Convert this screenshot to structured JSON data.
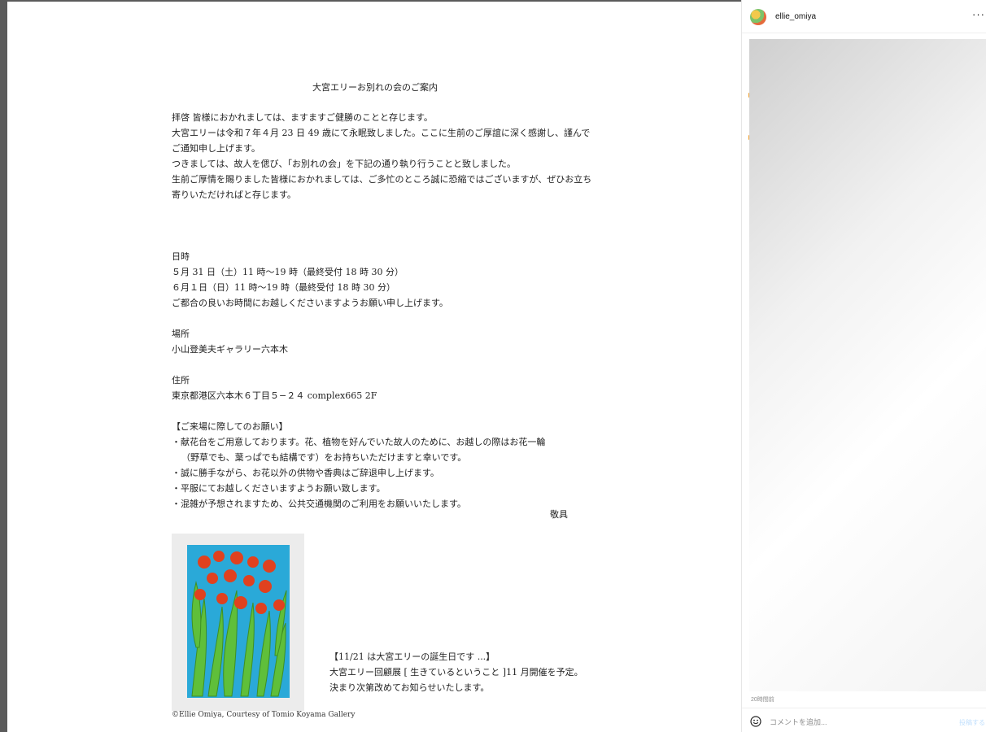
{
  "document": {
    "title": "大宮エリーお別れの会のご案内",
    "intro": [
      "拝啓 皆様におかれましては、ますますご健勝のことと存じます。",
      "大宮エリーは令和７年４月 23 日 49 歳にて永眠致しました。ここに生前のご厚誼に深く感謝し、謹んで",
      "ご通知申し上げます。",
      "つきましては、故人を偲び、「お別れの会」を下記の通り執り行うことと致しました。",
      "生前ご厚情を賜りました皆様におかれましては、ご多忙のところ誠に恐縮ではございますが、ぜひお立ち",
      "寄りいただければと存じます。"
    ],
    "date_section": {
      "heading": "日時",
      "lines": [
        "５月 31 日（土）11 時〜19 時（最終受付 18 時 30 分）",
        "６月１日（日）11 時〜19 時（最終受付 18 時 30 分）",
        "ご都合の良いお時間にお越しくださいますようお願い申し上げます。"
      ]
    },
    "venue_section": {
      "heading": "場所",
      "value": "小山登美夫ギャラリー六本木"
    },
    "address_section": {
      "heading": "住所",
      "value": "東京都港区六本木６丁目５−２４ complex665 2F"
    },
    "requests_section": {
      "heading": "【ご来場に際してのお願い】",
      "lines": [
        "・献花台をご用意しております。花、植物を好んでいた故人のために、お越しの際はお花一輪",
        "（野草でも、葉っぱでも結構です）をお持ちいただけますと幸いです。",
        "・誠に勝手ながら、お花以外の供物や香典はご辞退申し上げます。",
        "・平服にてお越しくださいますようお願い致します。",
        "・混雑が予想されますため、公共交通機関のご利用をお願いいたします。"
      ]
    },
    "closing": "敬具",
    "notice": [
      "【11/21 は大宮エリーの誕生日です ...】",
      "大宮エリー回顧展 [ 生きているということ ]11 月開催を予定。",
      "決まり次第改めてお知らせいたします。"
    ],
    "artwork_caption": "©Ellie Omiya, Courtesy of Tomio Koyama Gallery"
  },
  "post_panel": {
    "username": "ellie_omiya",
    "more_icon": "more-horizontal-icon",
    "timestamp": "20時間前",
    "comment_placeholder": "コメントを追加...",
    "post_label": "投稿する"
  },
  "colors": {
    "painting_background": "#2aa9d8",
    "flower": "#e0411f",
    "leaf": "#5fbf3a",
    "post_button": "#c0dffd"
  }
}
